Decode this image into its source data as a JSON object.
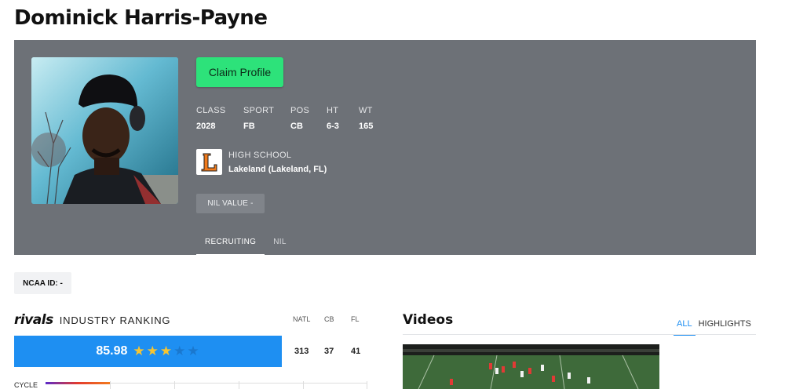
{
  "player": {
    "name": "Dominick Harris-Payne"
  },
  "hero": {
    "claim_label": "Claim Profile",
    "stats": [
      {
        "label": "CLASS",
        "value": "2028"
      },
      {
        "label": "SPORT",
        "value": "FB"
      },
      {
        "label": "POS",
        "value": "CB"
      },
      {
        "label": "HT",
        "value": "6-3"
      },
      {
        "label": "WT",
        "value": "165"
      }
    ],
    "school": {
      "label": "HIGH SCHOOL",
      "name": "Lakeland (Lakeland, FL)",
      "logo_letter": "L"
    },
    "nil_label": "NIL VALUE -",
    "tabs": [
      {
        "label": "RECRUITING",
        "active": true
      },
      {
        "label": "NIL",
        "active": false
      }
    ]
  },
  "ncaa": {
    "label": "NCAA ID:  -"
  },
  "ranking": {
    "brand": "rivals",
    "label": "INDUSTRY RANKING",
    "rating": "85.98",
    "stars_filled": 3,
    "stars_total": 5,
    "columns": [
      {
        "label": "NATL",
        "value": "313"
      },
      {
        "label": "CB",
        "value": "37"
      },
      {
        "label": "FL",
        "value": "41"
      }
    ],
    "cycle_label": "CYCLE"
  },
  "videos": {
    "title": "Videos",
    "tabs": [
      {
        "label": "ALL",
        "active": true
      },
      {
        "label": "HIGHLIGHTS",
        "active": false
      }
    ]
  },
  "colors": {
    "hero_bg": "#6d7177",
    "claim_green": "#2de27a",
    "rating_blue": "#1e8ff2",
    "star_gold": "#f7c531"
  }
}
